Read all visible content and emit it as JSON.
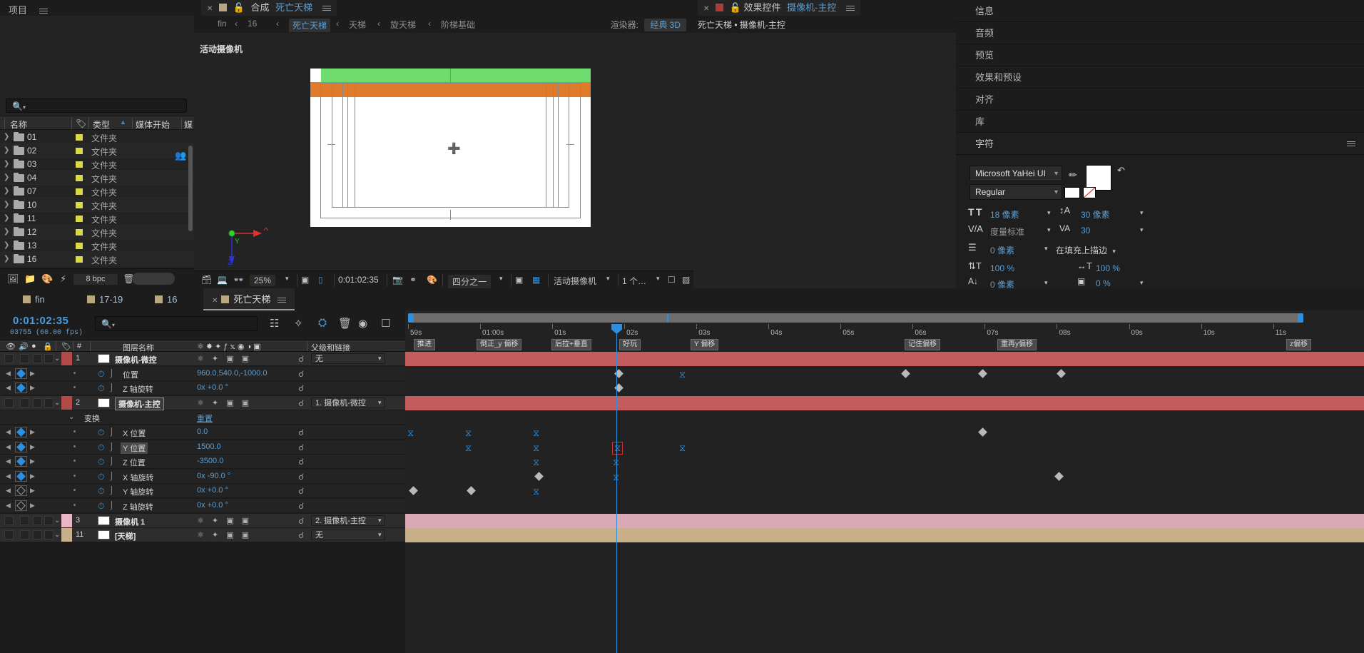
{
  "project": {
    "title": "项目",
    "search_placeholder": "",
    "columns": [
      "名称",
      "类型",
      "媒体开始",
      "媒"
    ],
    "sort_col": "类型",
    "rows": [
      {
        "name": "01",
        "type": "文件夹"
      },
      {
        "name": "02",
        "type": "文件夹"
      },
      {
        "name": "03",
        "type": "文件夹"
      },
      {
        "name": "04",
        "type": "文件夹"
      },
      {
        "name": "07",
        "type": "文件夹"
      },
      {
        "name": "10",
        "type": "文件夹"
      },
      {
        "name": "11",
        "type": "文件夹"
      },
      {
        "name": "12",
        "type": "文件夹"
      },
      {
        "name": "13",
        "type": "文件夹"
      },
      {
        "name": "16",
        "type": "文件夹"
      }
    ],
    "footer": {
      "bit_depth": "8 bpc"
    }
  },
  "comp": {
    "tab_prefix": "合成",
    "tab_name": "死亡天梯",
    "breadcrumb": [
      "fin",
      "16",
      "死亡天梯",
      "天梯",
      "旋天梯",
      "阶梯基础"
    ],
    "breadcrumb_current": "死亡天梯",
    "renderer_label": "渲染器:",
    "renderer_value": "经典 3D",
    "viewer_label": "活动摄像机",
    "toolbar": {
      "zoom": "25%",
      "time": "0:01:02:35",
      "resolution": "四分之一",
      "camera": "活动摄像机",
      "views": "1 个…"
    }
  },
  "effects": {
    "tab_prefix": "效果控件",
    "tab_name": "摄像机-主控",
    "subtitle": "死亡天梯 • 摄像机-主控"
  },
  "rail": {
    "items": [
      "信息",
      "音频",
      "预览",
      "效果和预设",
      "对齐",
      "库"
    ],
    "character": {
      "title": "字符",
      "font_family": "Microsoft YaHei UI",
      "font_style": "Regular",
      "font_size": "18 像素",
      "leading": "30 像素",
      "kerning": "度量标准",
      "tracking": "30",
      "stroke_width": "0 像素",
      "stroke_mode": "在填充上描边",
      "v_scale": "100 %",
      "h_scale": "100 %",
      "baseline_shift": "0 像素",
      "tsume": "0 %"
    }
  },
  "timeline": {
    "tabs": [
      {
        "label": "fin",
        "active": false
      },
      {
        "label": "17-19",
        "active": false
      },
      {
        "label": "16",
        "active": false
      },
      {
        "label": "死亡天梯",
        "active": true
      }
    ],
    "timecode": "0:01:02:35",
    "frame_info": "03755 (60.00 fps)",
    "search_placeholder": "",
    "columns": [
      "#",
      "图层名称",
      "父级和链接"
    ],
    "ruler_labels": [
      "59s",
      "01:00s",
      "01s",
      "02s",
      "03s",
      "04s",
      "05s",
      "06s",
      "07s",
      "08s",
      "09s",
      "10s",
      "11s"
    ],
    "markers": [
      "推进",
      "倒正_y 偏移",
      "后拉+垂直",
      "好玩",
      "Y 偏移",
      "记住偏移",
      "重再y偏移",
      "z偏移"
    ],
    "rows": [
      {
        "kind": "layer",
        "index": "1",
        "name": "摄像机-微控",
        "parent": "无",
        "color": "#b34a4a",
        "boxed": false
      },
      {
        "kind": "prop",
        "name": "位置",
        "value": "960.0,540.0,-1000.0",
        "kf": "solid"
      },
      {
        "kind": "prop",
        "name": "Z 轴旋转",
        "value": "0x +0.0 °",
        "kf": "solid"
      },
      {
        "kind": "layer",
        "index": "2",
        "name": "摄像机-主控",
        "parent": "1. 摄像机-微控",
        "color": "#b34a4a",
        "boxed": true
      },
      {
        "kind": "group",
        "name": "变换",
        "value": "重置"
      },
      {
        "kind": "prop",
        "name": "X 位置",
        "value": "0.0",
        "kf": "solid"
      },
      {
        "kind": "prop",
        "name": "Y 位置",
        "value": "1500.0",
        "kf": "solid",
        "selected": true
      },
      {
        "kind": "prop",
        "name": "Z 位置",
        "value": "-3500.0",
        "kf": "solid"
      },
      {
        "kind": "prop",
        "name": "X 轴旋转",
        "value": "0x -90.0 °",
        "kf": "solid"
      },
      {
        "kind": "prop",
        "name": "Y 轴旋转",
        "value": "0x +0.0 °",
        "kf": "hollow"
      },
      {
        "kind": "prop",
        "name": "Z 轴旋转",
        "value": "0x +0.0 °",
        "kf": "hollow"
      },
      {
        "kind": "layer",
        "index": "3",
        "name": "摄像机 1",
        "parent": "2. 摄像机-主控",
        "color": "#e8b6c4",
        "boxed": false
      },
      {
        "kind": "layer",
        "index": "11",
        "name": "[天梯]",
        "parent": "无",
        "color": "#c8b08a",
        "boxed": false
      }
    ]
  },
  "colors": {
    "accent": "#2c8fe0",
    "panel_bg": "#1c1c1c",
    "row_bg": "#232323",
    "layer_red": "#b34a4a",
    "band_red": "#c35c5c",
    "band_pink": "#d9aab6",
    "band_tan": "#c8b08a",
    "label_yellow": "#d9d94a",
    "green_band": "#6fdc6f",
    "orange_band": "#de7b2c"
  }
}
